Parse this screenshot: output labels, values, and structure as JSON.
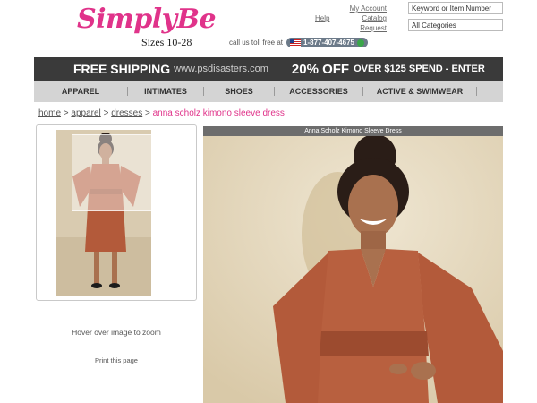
{
  "header": {
    "logo_text": "SimplyBe",
    "sizes": "Sizes 10-28",
    "my_account": "My Account",
    "help": "Help",
    "catalog_request": "Catalog Request",
    "call_us": "call us toll free at",
    "phone": "1-877-407-4675",
    "search_placeholder": "Keyword or Item Number",
    "category_selected": "All Categories"
  },
  "promo": {
    "free_shipping": "FREE SHIPPING",
    "url": "www.psdisasters.com",
    "discount": "20% OFF",
    "spend": "OVER $125 SPEND - ENTER"
  },
  "nav": {
    "items": [
      "APPAREL",
      "INTIMATES",
      "SHOES",
      "ACCESSORIES",
      "ACTIVE & SWIMWEAR"
    ]
  },
  "breadcrumb": {
    "home": "home",
    "apparel": "apparel",
    "dresses": "dresses",
    "sep": ">",
    "current": "anna scholz kimono sleeve dress"
  },
  "product": {
    "image_title": "Anna Scholz Kimono Sleeve Dress",
    "hover_text": "Hover over image to zoom",
    "print_link": "Print this page"
  },
  "colors": {
    "brand_pink": "#e0338a",
    "dress_rust": "#b35a3a",
    "promo_bg": "#3a3a3a",
    "nav_bg": "#d4d4d4"
  }
}
